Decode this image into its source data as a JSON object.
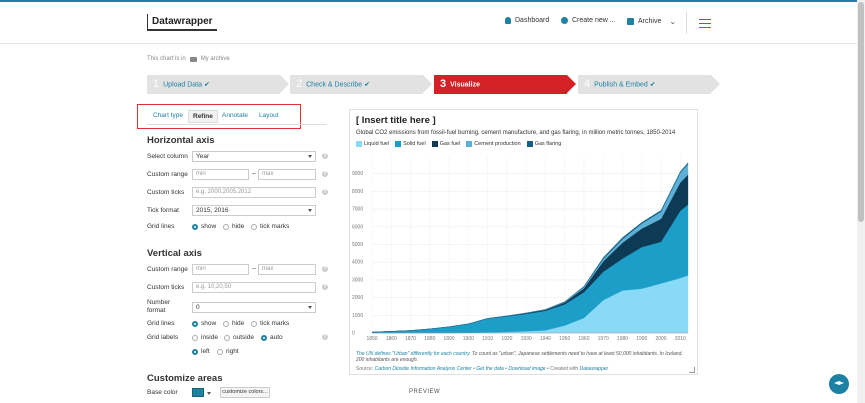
{
  "header": {
    "logo": "Datawrapper",
    "nav": {
      "dashboard": "Dashboard",
      "create_new": "Create new ...",
      "archive": "Archive"
    }
  },
  "breadcrumb": {
    "prefix": "This chart is in",
    "folder": "My archive"
  },
  "steps": [
    {
      "num": "1",
      "label": "Upload Data"
    },
    {
      "num": "2",
      "label": "Check & Describe"
    },
    {
      "num": "3",
      "label": "Visualize"
    },
    {
      "num": "4",
      "label": "Publish & Embed"
    }
  ],
  "tabs": [
    "Chart type",
    "Refine",
    "Annotate",
    "Layout"
  ],
  "horizontal_axis": {
    "title": "Horizontal axis",
    "select_column_label": "Select column",
    "select_column_value": "Year",
    "custom_range_label": "Custom range",
    "range_min_placeholder": "min",
    "range_max_placeholder": "max",
    "custom_ticks_label": "Custom ticks",
    "custom_ticks_placeholder": "e.g. 2000,2005,2012",
    "tick_format_label": "Tick format",
    "tick_format_value": "2015, 2016",
    "grid_lines_label": "Grid lines",
    "grid_options": [
      "show",
      "hide",
      "tick marks"
    ]
  },
  "vertical_axis": {
    "title": "Vertical axis",
    "custom_range_label": "Custom range",
    "range_min_placeholder": "min",
    "range_max_placeholder": "max",
    "custom_ticks_label": "Custom ticks",
    "custom_ticks_placeholder": "e.g. 10,20,50",
    "number_format_label_1": "Number",
    "number_format_label_2": "format",
    "number_format_value": "0",
    "grid_lines_label": "Grid lines",
    "grid_options": [
      "show",
      "hide",
      "tick marks"
    ],
    "grid_labels_label": "Grid labels",
    "grid_label_options": [
      "inside",
      "outside",
      "auto"
    ],
    "grid_label_align": [
      "left",
      "right"
    ]
  },
  "customize_areas": {
    "title": "Customize areas",
    "base_color_label": "Base color",
    "customize_colors_button": "customize colors..."
  },
  "preview_label": "PREVIEW",
  "chart": {
    "title": "[ Insert title here ]",
    "subtitle": "Global CO2 emissions from fossil-fuel burning, cement manufacture, and gas flaring, in million metric tonnes, 1850-2014",
    "note_link": "The UN defines \"Urban\" differently for each country.",
    "note_text": " To count as \"urban\", Japanese settlements need to have at least 50,000 inhabitants. In Iceland, 200 inhabitants are enough.",
    "source_label": "Source:",
    "source_name": "Carbon Dioxide Information Analysis Center",
    "get_data": "Get the data",
    "download_image": "Download image",
    "created_with": "Created with",
    "created_tool": "Datawrapper"
  },
  "chart_data": {
    "type": "area",
    "stacked": true,
    "ylim": [
      0,
      10000
    ],
    "yticks": [
      0,
      1000,
      2000,
      3000,
      4000,
      5000,
      6000,
      7000,
      8000,
      9000
    ],
    "xticks": [
      1850,
      1860,
      1870,
      1880,
      1890,
      1900,
      1910,
      1920,
      1930,
      1940,
      1950,
      1960,
      1970,
      1980,
      1990,
      2000,
      2010
    ],
    "x": [
      1850,
      1860,
      1870,
      1880,
      1890,
      1900,
      1910,
      1920,
      1930,
      1940,
      1950,
      1960,
      1970,
      1980,
      1990,
      2000,
      2010,
      2014
    ],
    "series": [
      {
        "name": "Liquid fuel",
        "color": "#88daf7",
        "values": [
          0,
          0,
          0,
          0,
          0,
          10,
          30,
          60,
          100,
          150,
          420,
          850,
          1850,
          2400,
          2500,
          2800,
          3100,
          3250
        ]
      },
      {
        "name": "Solid fuel",
        "color": "#1d9ec9",
        "values": [
          50,
          90,
          140,
          230,
          350,
          500,
          780,
          880,
          980,
          1100,
          1200,
          1450,
          1600,
          1800,
          2350,
          2350,
          3800,
          4000
        ]
      },
      {
        "name": "Gas fuel",
        "color": "#0d3b55",
        "values": [
          0,
          0,
          0,
          0,
          0,
          5,
          10,
          20,
          40,
          60,
          100,
          230,
          600,
          900,
          1050,
          1300,
          1600,
          1700
        ]
      },
      {
        "name": "Cement production",
        "color": "#5fb0d6",
        "values": [
          0,
          0,
          0,
          0,
          0,
          0,
          5,
          5,
          10,
          15,
          30,
          70,
          130,
          200,
          280,
          400,
          550,
          600
        ]
      },
      {
        "name": "Gas flaring",
        "color": "#0f5f86",
        "values": [
          0,
          0,
          0,
          0,
          0,
          0,
          0,
          0,
          0,
          10,
          20,
          40,
          80,
          90,
          70,
          80,
          70,
          70
        ]
      }
    ]
  }
}
